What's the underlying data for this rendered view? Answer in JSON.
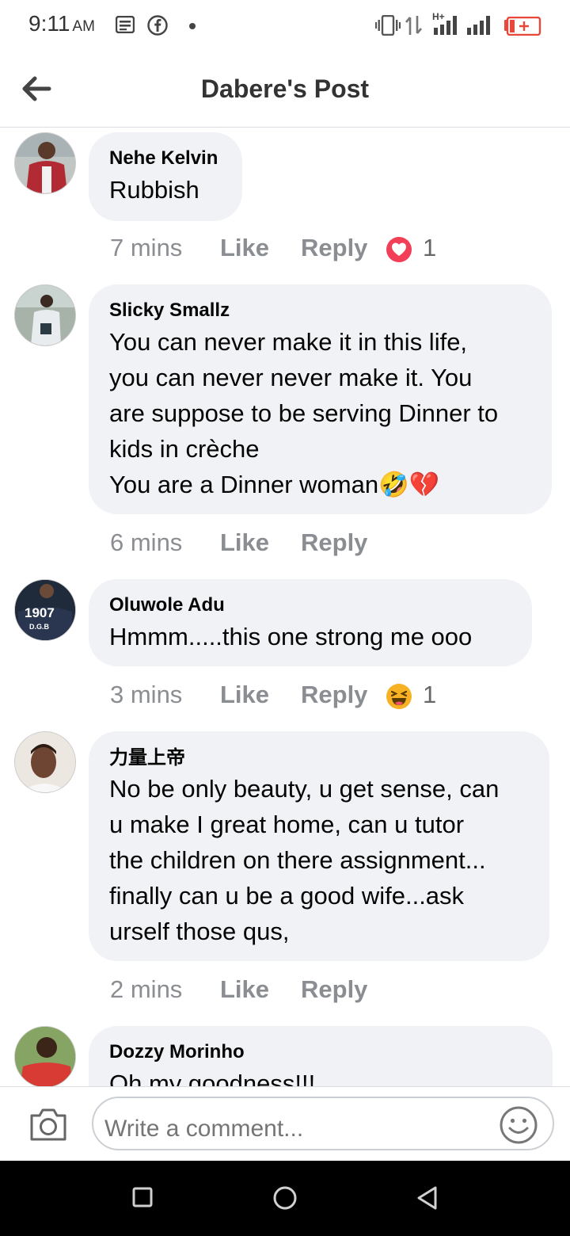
{
  "status_bar": {
    "time": "9:11",
    "ampm": "AM",
    "network": "H+"
  },
  "header": {
    "title": "Dabere's Post"
  },
  "comments": [
    {
      "author": "Nehe Kelvin",
      "text": "Rubbish",
      "time": "7 mins",
      "like_label": "Like",
      "reply_label": "Reply",
      "reaction_icon": "heart-reaction-icon",
      "reaction_count": "1",
      "avatar_color": "#b22b34"
    },
    {
      "author": "Slicky Smallz",
      "text": "You can never make it in this life,\nyou can never never make it. You\nare suppose to be serving Dinner to\nkids in crèche\nYou are a Dinner woman🤣💔",
      "time": "6 mins",
      "like_label": "Like",
      "reply_label": "Reply",
      "avatar_color": "#7d8d7a"
    },
    {
      "author": "Oluwole Adu",
      "text": "Hmmm.....this one strong me ooo",
      "time": "3 mins",
      "like_label": "Like",
      "reply_label": "Reply",
      "reaction_icon": "haha-reaction-icon",
      "reaction_count": "1",
      "avatar_color": "#1f2a3a",
      "avatar_text": "1907",
      "avatar_subtext": "D.G.B"
    },
    {
      "author": "力量上帝",
      "text": "No be only beauty, u get sense, can\nu make I great home, can u tutor\nthe children on there assignment...\nfinally can u be a good wife...ask\nurself those qus,",
      "time": "2 mins",
      "like_label": "Like",
      "reply_label": "Reply",
      "avatar_color": "#d9cfc4"
    },
    {
      "author": "Dozzy Morinho",
      "text": "Oh my goodness!!!",
      "avatar_color": "#c4312f"
    }
  ],
  "composer": {
    "placeholder": "Write a comment..."
  },
  "colors": {
    "bubble": "#f0f2f5",
    "secondary_text": "#8a8d91",
    "heart": "#f33e58",
    "haha": "#f7b125",
    "battery_low": "#e8483a"
  }
}
